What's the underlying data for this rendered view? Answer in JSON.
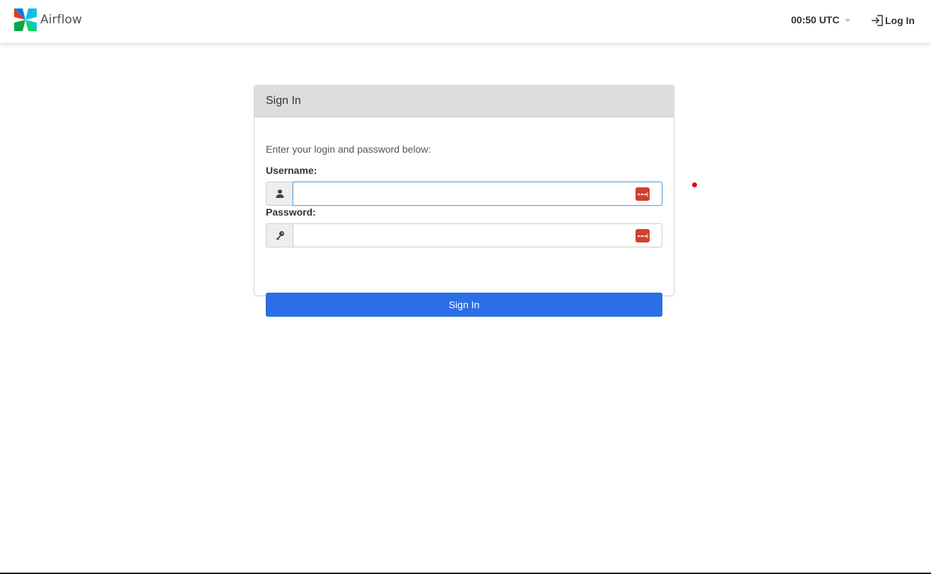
{
  "brand": {
    "name": "Airflow",
    "logo_colors": [
      "#017cee",
      "#00ad46",
      "#e43921",
      "#04d659"
    ]
  },
  "navbar": {
    "clock_label": "00:50 UTC",
    "login_label": "Log In"
  },
  "panel": {
    "heading": "Sign In",
    "intro": "Enter your login and password below:",
    "username_label": "Username:",
    "username_value": "",
    "password_label": "Password:",
    "password_value": "",
    "submit_label": "Sign In"
  },
  "icons": {
    "user": "user-icon",
    "key": "key-icon",
    "password_manager": "password-manager-icon",
    "login": "sign-in-icon",
    "caret": "chevron-down-icon"
  },
  "colors": {
    "primary_button": "#2a6ee8",
    "panel_heading_bg": "#dddddd",
    "password_manager": "#d13f2e",
    "focus_border": "#66afe9",
    "cursor_marker": "#e60000"
  }
}
